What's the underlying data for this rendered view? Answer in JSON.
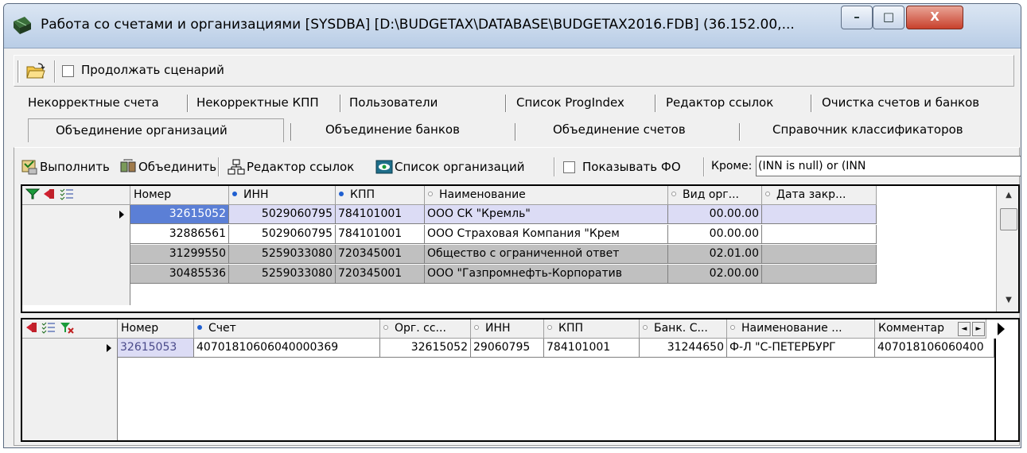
{
  "window": {
    "title": "Работа со счетами и организациями [SYSDBA] [D:\\BUDGETAX\\DATABASE\\BUDGETAX2016.FDB] (36.152.00,...",
    "minimize_label": "–",
    "maximize_label": "□",
    "close_label": "X"
  },
  "toolbar": {
    "continue_scenario_label": "Продолжать сценарий",
    "continue_scenario_checked": false
  },
  "tabs": {
    "row1": [
      {
        "label": "Некорректные счета"
      },
      {
        "label": "Некорректные КПП"
      },
      {
        "label": "Пользователи"
      },
      {
        "label": "Список ProgIndex"
      },
      {
        "label": "Редактор ссылок"
      },
      {
        "label": "Очистка счетов и банков"
      }
    ],
    "row2": [
      {
        "label": "Объединение организаций",
        "active": true
      },
      {
        "label": "Объединение банков"
      },
      {
        "label": "Объединение счетов"
      },
      {
        "label": "Справочник классификаторов"
      }
    ]
  },
  "actions": {
    "execute_label": "Выполнить",
    "merge_label": "Объединить",
    "link_editor_label": "Редактор ссылок",
    "org_list_label": "Список организаций",
    "show_fo_label": "Показывать ФО",
    "show_fo_checked": false,
    "except_label": "Кроме:",
    "except_value": "(INN is null) or (INN"
  },
  "orgs_grid": {
    "columns": [
      {
        "label": "Номер",
        "marker": "none"
      },
      {
        "label": "ИНН",
        "marker": "blue"
      },
      {
        "label": "КПП",
        "marker": "blue"
      },
      {
        "label": "Наименование",
        "marker": "gray"
      },
      {
        "label": "Вид орг...",
        "marker": "gray"
      },
      {
        "label": "Дата закр...",
        "marker": "gray"
      }
    ],
    "rows": [
      {
        "num": "32615052",
        "inn": "5029060795",
        "kpp": "784101001",
        "name": "ООО СК \"Кремль\"",
        "kind": "00.00.00",
        "date": "",
        "current": true,
        "style": "selected"
      },
      {
        "num": "32886561",
        "inn": "5029060795",
        "kpp": "784101001",
        "name": "ООО Страховая Компания \"Крем",
        "kind": "00.00.00",
        "date": "",
        "current": false,
        "style": "white"
      },
      {
        "num": "31299550",
        "inn": "5259033080",
        "kpp": "720345001",
        "name": "Общество с ограниченной ответ",
        "kind": "02.01.00",
        "date": "",
        "current": false,
        "style": "gray"
      },
      {
        "num": "30485536",
        "inn": "5259033080",
        "kpp": "720345001",
        "name": "ООО \"Газпромнефть-Корпоратив",
        "kind": "02.00.00",
        "date": "",
        "current": false,
        "style": "gray"
      }
    ]
  },
  "accounts_grid": {
    "columns": [
      {
        "label": "Номер",
        "marker": "none"
      },
      {
        "label": "Счет",
        "marker": "blue"
      },
      {
        "label": "Орг. сс...",
        "marker": "gray"
      },
      {
        "label": "ИНН",
        "marker": "gray"
      },
      {
        "label": "КПП",
        "marker": "gray"
      },
      {
        "label": "Банк. С...",
        "marker": "gray"
      },
      {
        "label": "Наименование ...",
        "marker": "gray"
      },
      {
        "label": "Комментар",
        "marker": "none"
      }
    ],
    "rows": [
      {
        "num": "32615053",
        "account": "40701810606040000369",
        "org": "32615052",
        "inn": "29060795",
        "kpp": "784101001",
        "bank": "31244650",
        "name": "Ф-Л \"С-ПЕТЕРБУРГ",
        "comment": "407018106060400"
      }
    ]
  },
  "colors": {
    "selected_row": "#dcdcf5",
    "focus_cell": "#5b7fd6",
    "gray_row": "#c0c0c0",
    "grid_border": "#000000"
  }
}
